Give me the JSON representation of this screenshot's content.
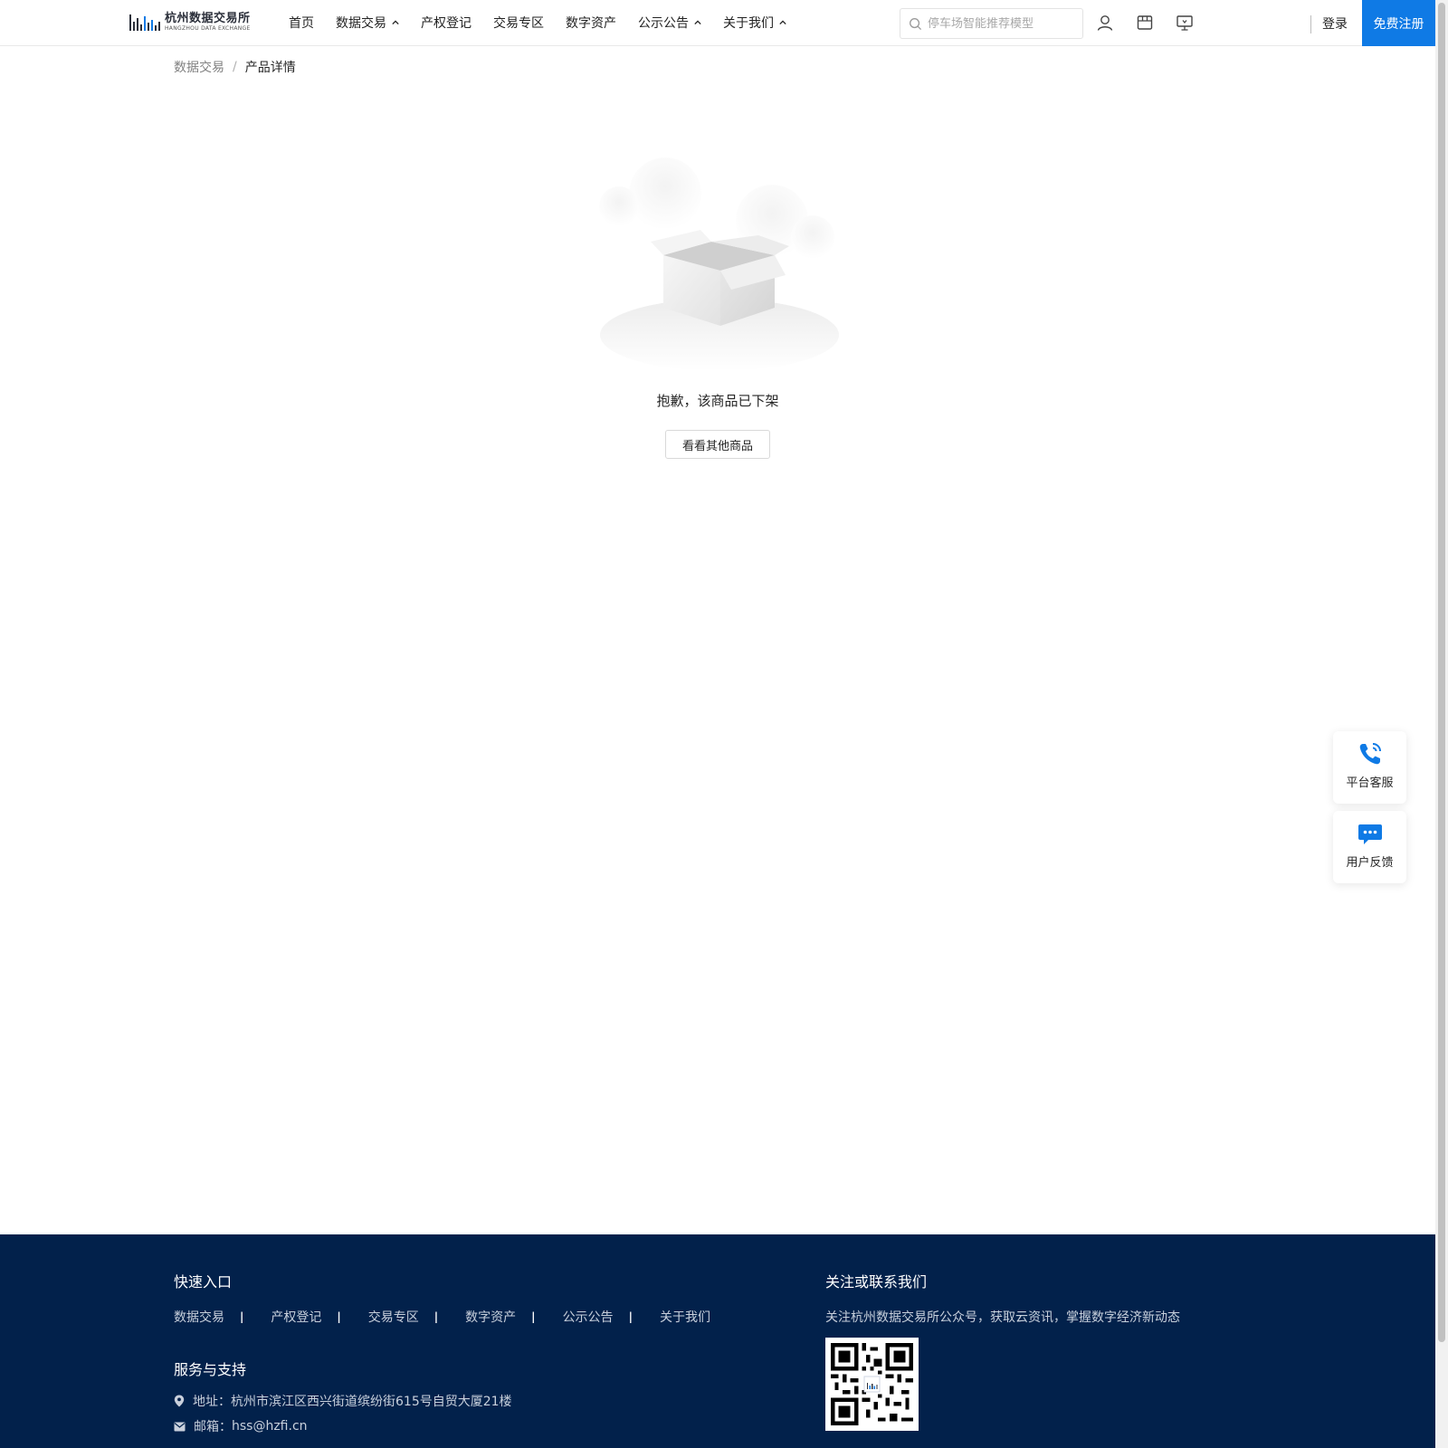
{
  "header": {
    "logo": {
      "cn": "杭州数据交易所",
      "en": "HANGZHOU DATA EXCHANGE"
    },
    "nav": [
      {
        "label": "首页",
        "has_dropdown": false
      },
      {
        "label": "数据交易",
        "has_dropdown": true
      },
      {
        "label": "产权登记",
        "has_dropdown": false
      },
      {
        "label": "交易专区",
        "has_dropdown": false
      },
      {
        "label": "数字资产",
        "has_dropdown": false
      },
      {
        "label": "公示公告",
        "has_dropdown": true
      },
      {
        "label": "关于我们",
        "has_dropdown": true
      }
    ],
    "search": {
      "placeholder": "停车场智能推荐模型",
      "value": ""
    },
    "icons": [
      "user-icon",
      "store-icon",
      "monitor-icon"
    ],
    "login_label": "登录",
    "register_label": "免费注册",
    "accent_color": "#0f7ae5"
  },
  "breadcrumb": {
    "parent": "数据交易",
    "separator": "/",
    "current": "产品详情"
  },
  "empty_state": {
    "illustration": "empty-box-icon",
    "message": "抱歉，该商品已下架",
    "button_label": "看看其他商品"
  },
  "floating": {
    "service": {
      "label": "平台客服",
      "icon": "phone-icon"
    },
    "feedback": {
      "label": "用户反馈",
      "icon": "chat-icon"
    }
  },
  "footer": {
    "bg_color": "#02214b",
    "quick_title": "快速入口",
    "quick_links": [
      "数据交易",
      "产权登记",
      "交易专区",
      "数字资产",
      "公示公告",
      "关于我们"
    ],
    "support_title": "服务与支持",
    "address": "地址：杭州市滨江区西兴街道缤纷街615号自贸大厦21楼",
    "email_label": "邮箱：",
    "email": "hss@hzfi.cn",
    "follow_title": "关注或联系我们",
    "follow_desc": "关注杭州数据交易所公众号，获取云资讯，掌握数字经济新动态"
  }
}
